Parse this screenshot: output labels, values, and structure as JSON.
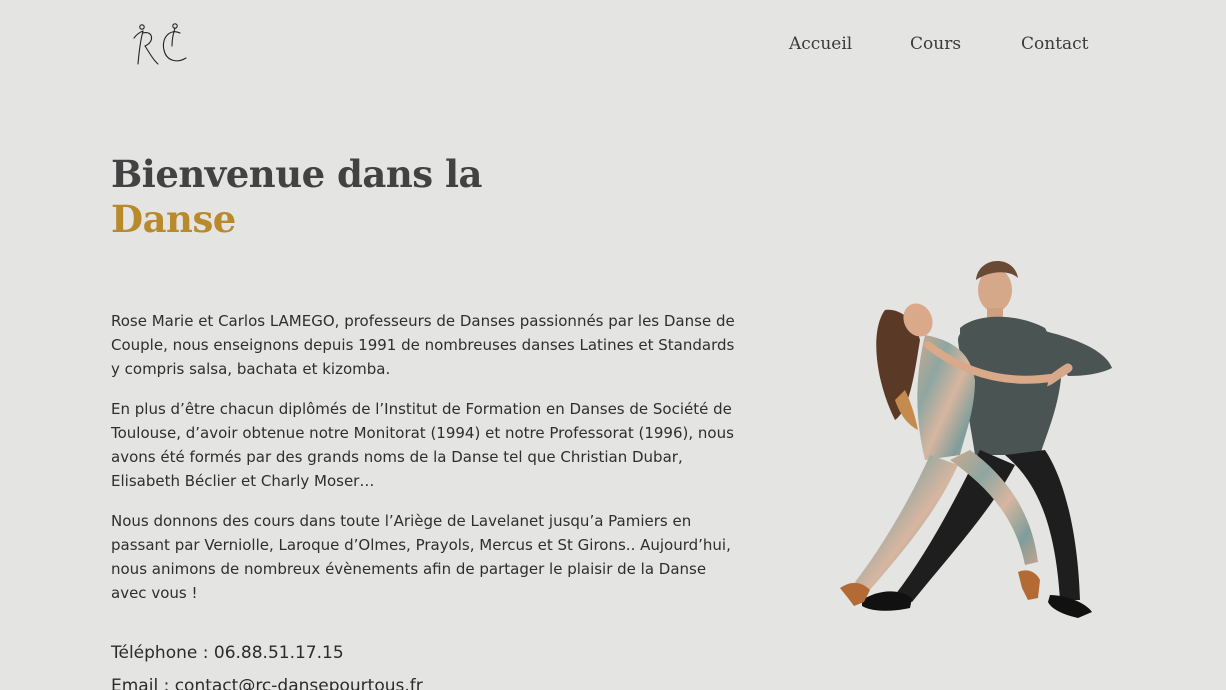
{
  "logo": {
    "alt": "RC",
    "icon": "dancers-logo-icon"
  },
  "nav": {
    "items": [
      {
        "label": "Accueil"
      },
      {
        "label": "Cours"
      },
      {
        "label": "Contact"
      }
    ]
  },
  "hero": {
    "title_line1": "Bienvenue dans la",
    "title_line2": "Danse",
    "accent_color": "#b98a2c",
    "paragraphs": [
      "Rose Marie et Carlos LAMEGO, professeurs de Danses passionnés par les Danse de Couple, nous enseignons depuis 1991 de nombreuses danses Latines et Standards y compris salsa, bachata et kizomba.",
      "En plus d’être chacun diplômés de l’Institut de Formation en Danses de Société de Toulouse, d’avoir obtenue notre Monitorat (1994) et notre Professorat (1996), nous avons été formés par des grands noms de la Danse tel que Christian Dubar, Elisabeth Béclier et Charly Moser…",
      "Nous donnons des cours dans toute l’Ariège de Lavelanet jusqu’a Pamiers en passant par Verniolle, Laroque d’Olmes, Prayols, Mercus et St Girons.. Aujourd’hui, nous animons de nombreux évènements afin de partager le plaisir de la Danse avec vous !"
    ],
    "phone": "Téléphone : 06.88.51.17.15",
    "email": "Email : contact@rc-dansepourtous.fr"
  },
  "image": {
    "icon": "dancing-couple-photo"
  }
}
